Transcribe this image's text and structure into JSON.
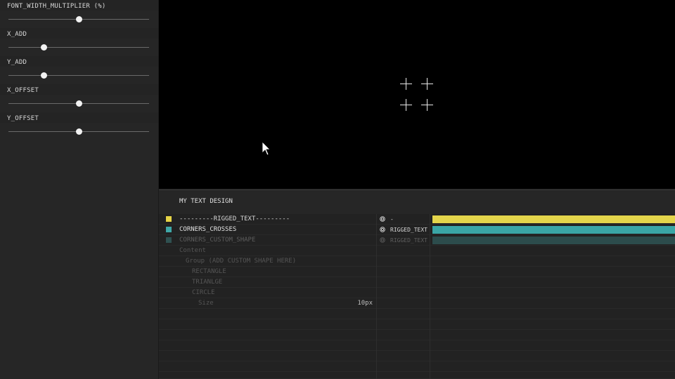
{
  "controls": {
    "sliders": [
      {
        "label": "FONT_WIDTH_MULTIPLIER (%)",
        "value": 0.5
      },
      {
        "label": "X_ADD",
        "value": 0.25
      },
      {
        "label": "Y_ADD",
        "value": 0.25
      },
      {
        "label": "X_OFFSET",
        "value": 0.5
      },
      {
        "label": "Y_OFFSET",
        "value": 0.5
      }
    ]
  },
  "viewport": {
    "background": "#000000",
    "marks": [
      "crosshair-icon",
      "crosshair-icon",
      "crosshair-icon",
      "crosshair-icon"
    ],
    "cursor": "mouse-pointer-icon"
  },
  "composition": {
    "title": "MY TEXT DESIGN"
  },
  "layers": [
    {
      "name": "---------RIGGED_TEXT---------",
      "color": "#e6d446",
      "parent": "-",
      "bar_color": "#e4d54b",
      "state": "enabled"
    },
    {
      "name": "CORNERS_CROSSES",
      "color": "#3fa8a8",
      "parent": "RIGGED_TEXT",
      "bar_color": "#3aa6a6",
      "state": "enabled"
    },
    {
      "name": "CORNERS_CUSTOM_SHAPE",
      "color": "#2f5151",
      "parent": "RIGGED_TEXT",
      "bar_color": "#2c4c4c",
      "state": "disabled"
    }
  ],
  "properties": [
    {
      "label": "Content",
      "indent": 0,
      "value": ""
    },
    {
      "label": "Group (ADD CUSTOM SHAPE HERE)",
      "indent": 1,
      "value": ""
    },
    {
      "label": "RECTANGLE",
      "indent": 2,
      "value": ""
    },
    {
      "label": "TRIANLGE",
      "indent": 2,
      "value": ""
    },
    {
      "label": "CIRCLE",
      "indent": 2,
      "value": ""
    },
    {
      "label": "Size",
      "indent": 3,
      "value": "10px"
    }
  ]
}
